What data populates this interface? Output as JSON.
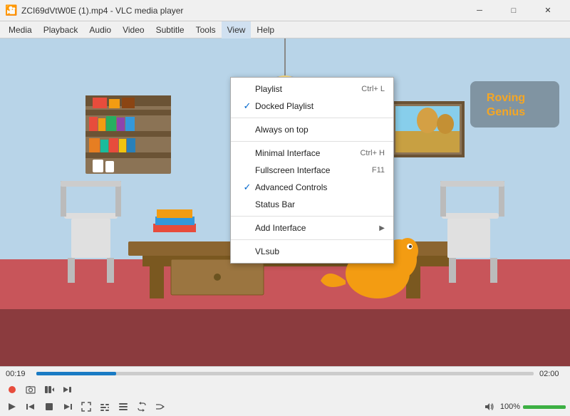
{
  "window": {
    "title": "ZCI69dVtW0E (1).mp4 - VLC media player",
    "icon": "🎦"
  },
  "window_controls": {
    "minimize": "─",
    "maximize": "□",
    "close": "✕"
  },
  "menu_bar": {
    "items": [
      "Media",
      "Playback",
      "Audio",
      "Video",
      "Subtitle",
      "Tools",
      "View",
      "Help"
    ]
  },
  "dropdown": {
    "active_menu": "View",
    "items": [
      {
        "id": "playlist",
        "check": false,
        "label": "Playlist",
        "shortcut": "Ctrl+ L",
        "arrow": false
      },
      {
        "id": "docked-playlist",
        "check": true,
        "label": "Docked Playlist",
        "shortcut": "",
        "arrow": false
      },
      {
        "id": "separator1",
        "type": "separator"
      },
      {
        "id": "always-on-top",
        "check": false,
        "label": "Always on top",
        "shortcut": "",
        "arrow": false
      },
      {
        "id": "separator2",
        "type": "separator"
      },
      {
        "id": "minimal-interface",
        "check": false,
        "label": "Minimal Interface",
        "shortcut": "Ctrl+ H",
        "arrow": false
      },
      {
        "id": "fullscreen-interface",
        "check": false,
        "label": "Fullscreen Interface",
        "shortcut": "F11",
        "arrow": false
      },
      {
        "id": "advanced-controls",
        "check": true,
        "label": "Advanced Controls",
        "shortcut": "",
        "arrow": false
      },
      {
        "id": "status-bar",
        "check": false,
        "label": "Status Bar",
        "shortcut": "",
        "arrow": false
      },
      {
        "id": "separator3",
        "type": "separator"
      },
      {
        "id": "add-interface",
        "check": false,
        "label": "Add Interface",
        "shortcut": "",
        "arrow": true
      },
      {
        "id": "separator4",
        "type": "separator"
      },
      {
        "id": "vlsub",
        "check": false,
        "label": "VLsub",
        "shortcut": "",
        "arrow": false
      }
    ]
  },
  "player": {
    "time_current": "00:19",
    "time_total": "02:00",
    "progress_percent": 16,
    "volume_percent": 100,
    "volume_label": "100%"
  },
  "controls_row1": {
    "buttons": [
      "record",
      "snapshot",
      "frame-by-frame",
      "step-forward"
    ]
  },
  "controls_row2": {
    "buttons": [
      "play",
      "prev",
      "stop",
      "next",
      "toggle-fullscreen",
      "extended-settings",
      "show-playlist",
      "loop",
      "shuffle",
      "mute"
    ]
  },
  "colors": {
    "accent": "#1a7bc4",
    "volume_bar": "#3cb043",
    "checked": "#0066cc"
  }
}
